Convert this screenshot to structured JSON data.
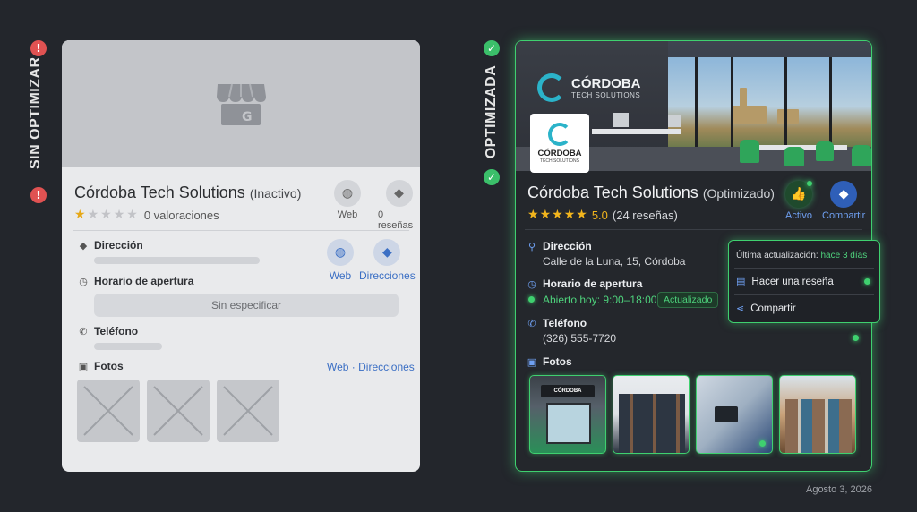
{
  "left_panel": {
    "label": "SIN OPTIMIZAR",
    "status_icon": "exclamation-icon",
    "card": {
      "business_name": "Córdoba Tech Solutions",
      "business_status": "(Inactivo)",
      "rating_stars": 1,
      "reviews_text": "0 valoraciones",
      "action_web": "Web",
      "action_reviews": "0 reseñas",
      "address_title": "Dirección",
      "hours_title": "Horario de apertura",
      "hours_value": "Sin especificar",
      "phone_title": "Teléfono",
      "photos_title": "Fotos",
      "side_web": "Web",
      "side_directions": "Direcciones",
      "photos_link": "Web · Direcciones"
    }
  },
  "right_panel": {
    "label": "OPTIMIZADA",
    "status_icon": "check-icon",
    "card": {
      "wall_logo_name": "CÓRDOBA",
      "wall_logo_sub": "TECH SOLUTIONS",
      "logo_name": "CÓRDOBA",
      "logo_sub": "TECH SOLUTIONS",
      "business_name": "Córdoba Tech Solutions",
      "business_status": "(Optimizado)",
      "rating_stars": 5,
      "rating_score": "5.0",
      "reviews_text": "(24 reseñas)",
      "action_active": "Activo",
      "action_share": "Compartir",
      "address_title": "Dirección",
      "address_value": "Calle de la Luna, 15, Córdoba",
      "hours_title": "Horario de apertura",
      "hours_value": "Abierto hoy: 9:00–18:00",
      "hours_badge": "Actualizado",
      "phone_title": "Teléfono",
      "phone_value": "(326) 555-7720",
      "photos_title": "Fotos",
      "photo_sign": "CÓRDOBA"
    },
    "popup": {
      "last_update_label": "Última actualización:",
      "last_update_value": "hace 3 días",
      "item_review": "Hacer una reseña",
      "item_share": "Compartir"
    }
  },
  "footer": {
    "date": "Agosto 3, 2026"
  },
  "colors": {
    "accent_green": "#3fd06f",
    "link_blue": "#6fa0f2",
    "star_gold": "#f2b51d",
    "warning_red": "#e05252"
  }
}
